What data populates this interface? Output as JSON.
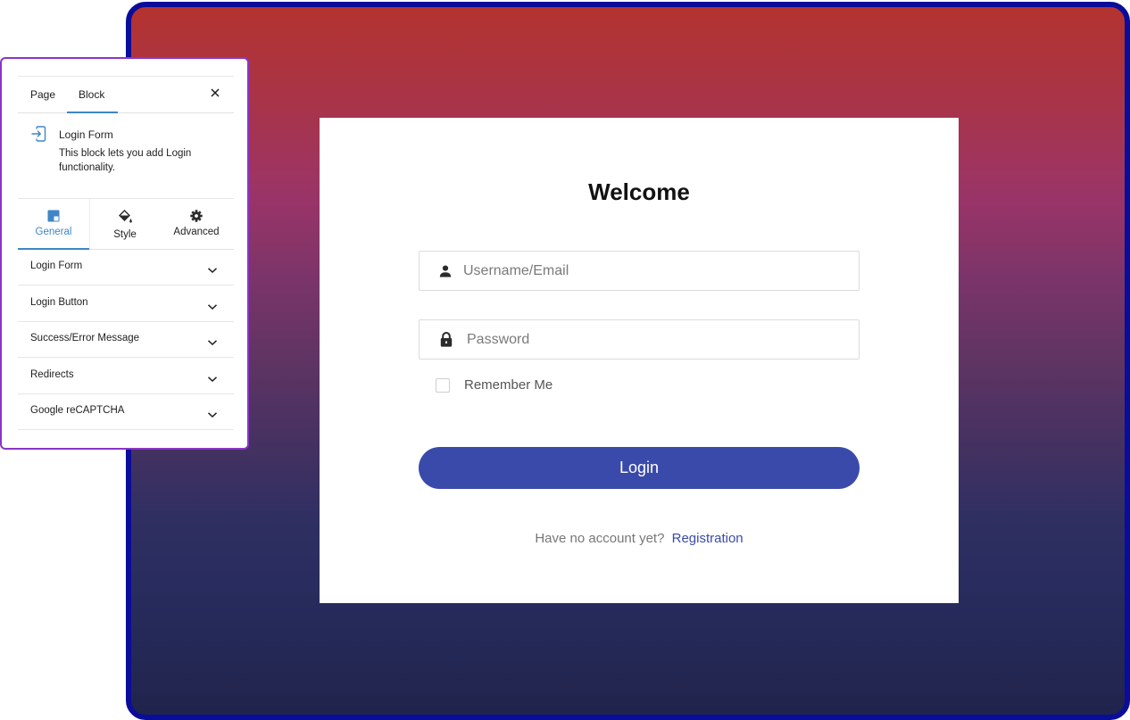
{
  "sidebar": {
    "tabs": [
      {
        "label": "Page",
        "active": false
      },
      {
        "label": "Block",
        "active": true
      }
    ],
    "close_icon": "close-icon",
    "block": {
      "icon": "login-icon",
      "title": "Login Form",
      "description": "This block lets you add Login functionality."
    },
    "settings_tabs": [
      {
        "label": "General",
        "icon": "layout-icon",
        "active": true
      },
      {
        "label": "Style",
        "icon": "paint-bucket-icon",
        "active": false
      },
      {
        "label": "Advanced",
        "icon": "gear-icon",
        "active": false
      }
    ],
    "sections": [
      {
        "label": "Login Form"
      },
      {
        "label": "Login Button"
      },
      {
        "label": "Success/Error Message"
      },
      {
        "label": "Redirects"
      },
      {
        "label": "Google reCAPTCHA"
      }
    ]
  },
  "form": {
    "title": "Welcome",
    "username": {
      "placeholder": "Username/Email",
      "value": "",
      "icon": "user-icon"
    },
    "password": {
      "placeholder": "Password",
      "value": "",
      "icon": "lock-icon"
    },
    "remember_label": "Remember Me",
    "remember_checked": false,
    "login_label": "Login",
    "register_prompt": "Have no account yet?",
    "register_link": "Registration"
  },
  "colors": {
    "accent": "#3a4aab",
    "frame_border": "#0a0c9a",
    "panel_border": "#8a35c8",
    "tab_active": "#3f86c6",
    "gradient_top": "#b3332f",
    "gradient_mid": "#9a3468",
    "gradient_bottom": "#20244c"
  }
}
